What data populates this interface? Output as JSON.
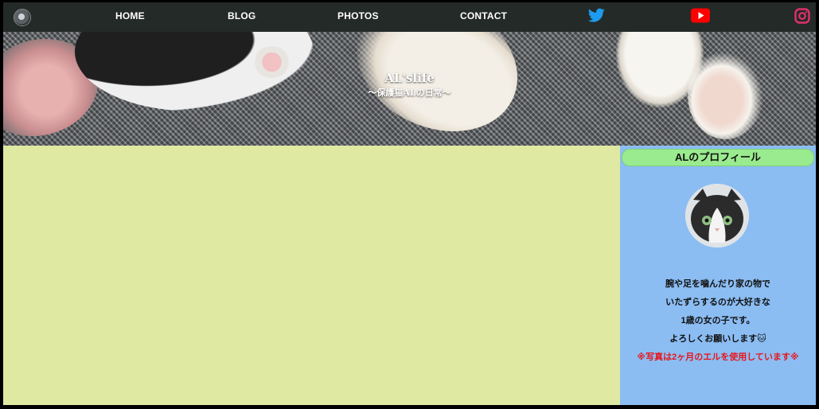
{
  "nav": {
    "items": [
      {
        "label": "HOME"
      },
      {
        "label": "BLOG"
      },
      {
        "label": "PHOTOS"
      },
      {
        "label": "CONTACT"
      }
    ],
    "social_icons": [
      "twitter-icon",
      "youtube-icon",
      "instagram-icon"
    ],
    "colors": {
      "background": "#242a27",
      "twitter": "#1d9bf0",
      "youtube": "#ff0000",
      "instagram": "#e1306c"
    }
  },
  "hero": {
    "title": "AL'slife",
    "subtitle": "〜保護猫ALの日常〜"
  },
  "main": {
    "background": "#dfe9a2"
  },
  "sidebar": {
    "heading": "ALのプロフィール",
    "lines": [
      "腕や足を噛んだり家の物で",
      "いたずらするのが大好きな",
      "1歳の女の子です。",
      "よろしくお願いします🐱"
    ],
    "note": "※写真は2ヶ月のエルを使用しています※",
    "colors": {
      "background": "#8bbdf3",
      "heading_bg": "#9aeb8f",
      "note": "#e8161b"
    }
  }
}
